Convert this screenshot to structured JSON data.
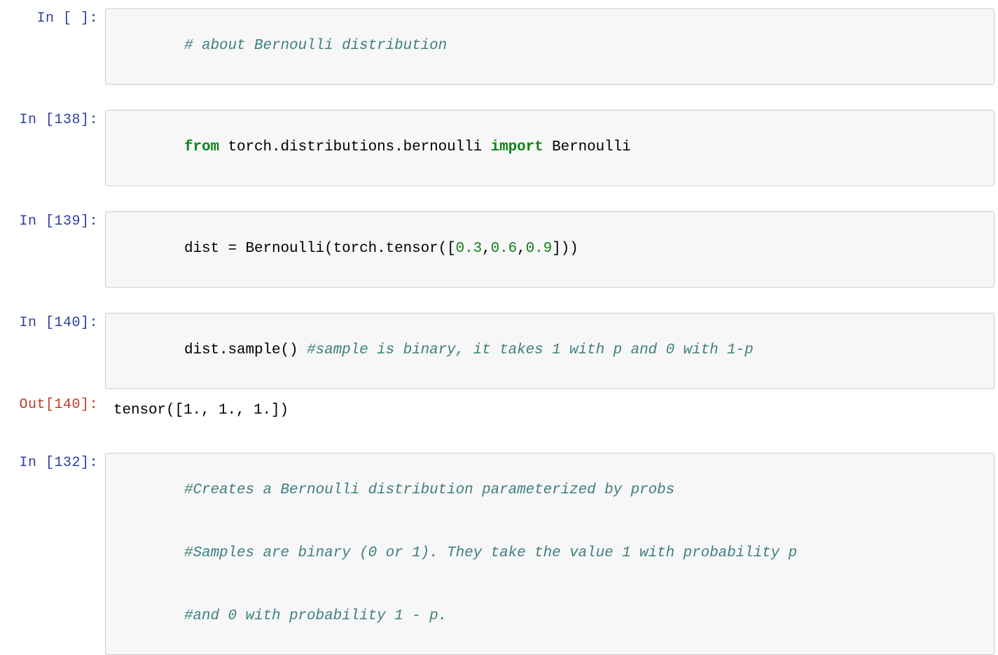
{
  "notebook": {
    "kernel_language": "python",
    "colors": {
      "prompt_in": "#303f9f",
      "prompt_out": "#c0392b",
      "keyword": "#11821b",
      "number": "#11821b",
      "comment": "#3f7f7f",
      "code_text": "#000000",
      "cell_background": "#f7f7f7",
      "cell_border": "#cfcfcf",
      "page_background": "#ffffff"
    },
    "cells": [
      {
        "type": "code",
        "prompt": "In [ ]:",
        "execution_count": "",
        "lines": [
          {
            "tokens": [
              {
                "kind": "comment",
                "text": "# about Bernoulli distribution"
              }
            ]
          }
        ]
      },
      {
        "type": "code",
        "prompt": "In [138]:",
        "execution_count": "138",
        "lines": [
          {
            "tokens": [
              {
                "kind": "keyword",
                "text": "from"
              },
              {
                "kind": "plain",
                "text": " torch.distributions.bernoulli "
              },
              {
                "kind": "keyword",
                "text": "import"
              },
              {
                "kind": "plain",
                "text": " Bernoulli"
              }
            ]
          }
        ]
      },
      {
        "type": "code",
        "prompt": "In [139]:",
        "execution_count": "139",
        "lines": [
          {
            "tokens": [
              {
                "kind": "plain",
                "text": "dist = Bernoulli(torch.tensor(["
              },
              {
                "kind": "number",
                "text": "0.3"
              },
              {
                "kind": "plain",
                "text": ","
              },
              {
                "kind": "number",
                "text": "0.6"
              },
              {
                "kind": "plain",
                "text": ","
              },
              {
                "kind": "number",
                "text": "0.9"
              },
              {
                "kind": "plain",
                "text": "]))"
              }
            ]
          }
        ]
      },
      {
        "type": "code",
        "prompt": "In [140]:",
        "execution_count": "140",
        "lines": [
          {
            "tokens": [
              {
                "kind": "plain",
                "text": "dist.sample() "
              },
              {
                "kind": "comment",
                "text": "#sample is binary, it takes 1 with p and 0 with 1-p"
              }
            ]
          }
        ]
      },
      {
        "type": "output",
        "prompt": "Out[140]:",
        "execution_count": "140",
        "lines": [
          {
            "text": "tensor([1., 1., 1.])"
          }
        ]
      },
      {
        "type": "code",
        "prompt": "In [132]:",
        "execution_count": "132",
        "lines": [
          {
            "tokens": [
              {
                "kind": "comment",
                "text": "#Creates a Bernoulli distribution parameterized by probs"
              }
            ]
          },
          {
            "tokens": [
              {
                "kind": "comment",
                "text": "#Samples are binary (0 or 1). They take the value 1 with probability p"
              }
            ]
          },
          {
            "tokens": [
              {
                "kind": "comment",
                "text": "#and 0 with probability 1 - p."
              }
            ]
          }
        ]
      }
    ]
  }
}
